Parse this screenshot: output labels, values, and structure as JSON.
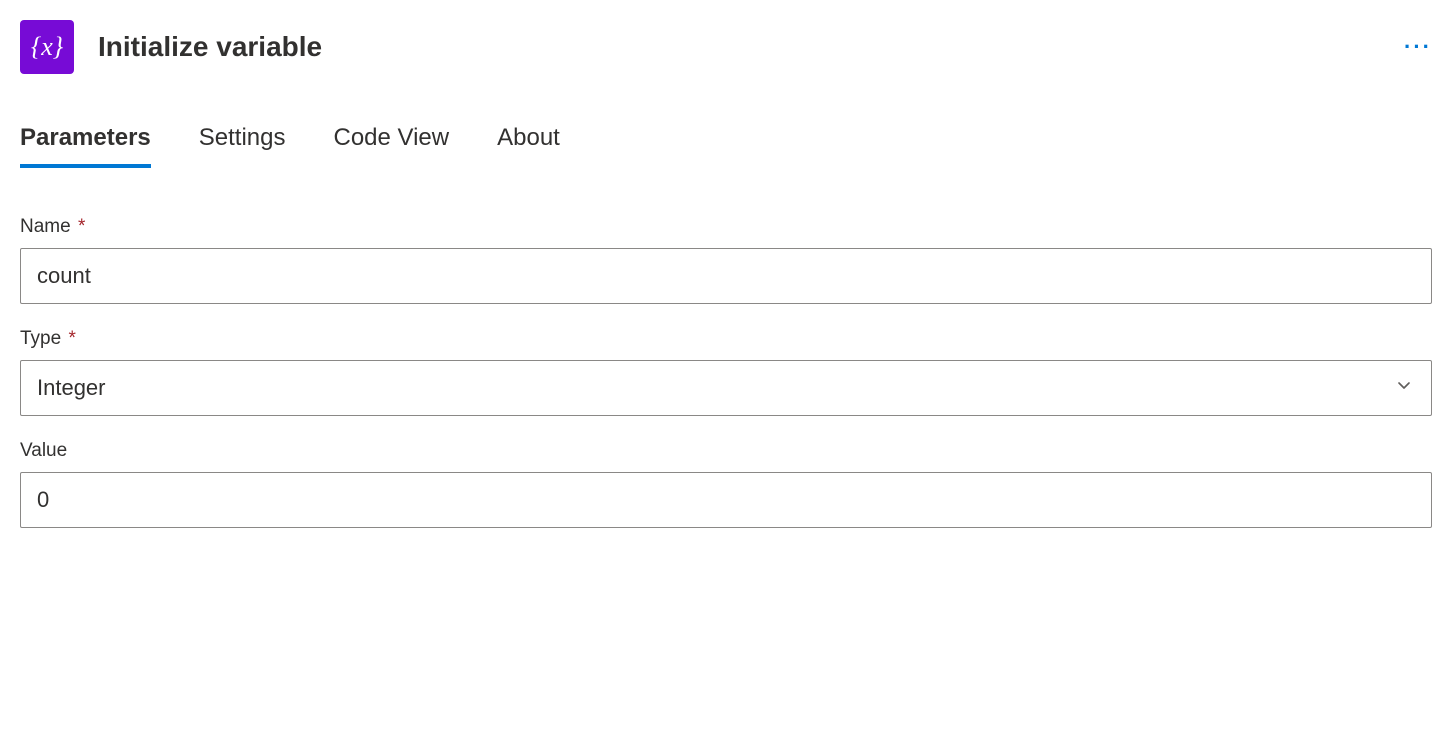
{
  "header": {
    "icon_glyph": "{x}",
    "title": "Initialize variable"
  },
  "tabs": [
    {
      "label": "Parameters",
      "active": true
    },
    {
      "label": "Settings",
      "active": false
    },
    {
      "label": "Code View",
      "active": false
    },
    {
      "label": "About",
      "active": false
    }
  ],
  "form": {
    "name": {
      "label": "Name",
      "required": true,
      "value": "count"
    },
    "type": {
      "label": "Type",
      "required": true,
      "value": "Integer"
    },
    "value": {
      "label": "Value",
      "required": false,
      "value": "0"
    }
  }
}
